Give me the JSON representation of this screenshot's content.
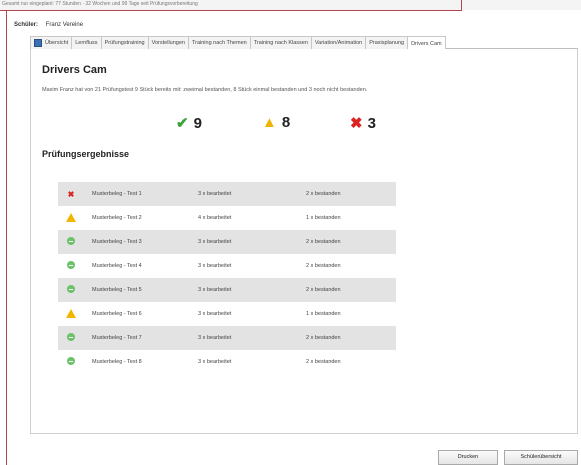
{
  "top_strip_text": "Gesamt nur eingeplant: 77 Stunden · 32 Wochen und 99 Tage seit Prüfungsvorbereitung",
  "student": {
    "label": "Schüler:",
    "name": "Franz Vereine"
  },
  "tabs": [
    {
      "label": "Übersicht",
      "active": false,
      "home": true
    },
    {
      "label": "Lernfluss",
      "active": false
    },
    {
      "label": "Prüfungstraining",
      "active": false
    },
    {
      "label": "Vorstellungen",
      "active": false
    },
    {
      "label": "Training nach Themen",
      "active": false
    },
    {
      "label": "Training nach Klassen",
      "active": false
    },
    {
      "label": "Variation/Animation",
      "active": false
    },
    {
      "label": "Praxisplanung",
      "active": false
    },
    {
      "label": "Drivers Cam",
      "active": true
    }
  ],
  "page": {
    "title": "Drivers Cam",
    "description": "Maxim Franz hat von 21 Prüfungstest 9 Stück bereits mit: zweimal bestanden, 8 Stück einmal bestanden und 3 noch nicht bestanden."
  },
  "summary": {
    "passed": {
      "icon": "check-icon",
      "count": "9"
    },
    "partial": {
      "icon": "warning-icon",
      "count": "8"
    },
    "failed": {
      "icon": "x-icon",
      "count": "3"
    }
  },
  "section_title": "Prüfungsergebnisse",
  "results": [
    {
      "status": "failed",
      "name": "Musterbeleg - Test 1",
      "worked": "3 x bearbeitet",
      "passed": "2 x bestanden"
    },
    {
      "status": "partial",
      "name": "Musterbeleg - Test 2",
      "worked": "4 x bearbeitet",
      "passed": "1 x bestanden"
    },
    {
      "status": "passed",
      "name": "Musterbeleg - Test 3",
      "worked": "3 x bearbeitet",
      "passed": "2 x bestanden"
    },
    {
      "status": "passed",
      "name": "Musterbeleg - Test 4",
      "worked": "3 x bearbeitet",
      "passed": "2 x bestanden"
    },
    {
      "status": "passed",
      "name": "Musterbeleg - Test 5",
      "worked": "3 x bearbeitet",
      "passed": "2 x bestanden"
    },
    {
      "status": "partial",
      "name": "Musterbeleg - Test 6",
      "worked": "3 x bearbeitet",
      "passed": "1 x bestanden"
    },
    {
      "status": "passed",
      "name": "Musterbeleg - Test 7",
      "worked": "3 x bearbeitet",
      "passed": "2 x bestanden"
    },
    {
      "status": "passed",
      "name": "Musterbeleg - Test 8",
      "worked": "3 x bearbeitet",
      "passed": "2 x bestanden"
    }
  ],
  "buttons": {
    "print": "Drucken",
    "close": "Schülerübersicht"
  },
  "colors": {
    "passed": "#3aa33a",
    "partial": "#f2b600",
    "failed": "#dd2222",
    "row_shade": "#e3e3e3",
    "frame": "#b0474f"
  }
}
